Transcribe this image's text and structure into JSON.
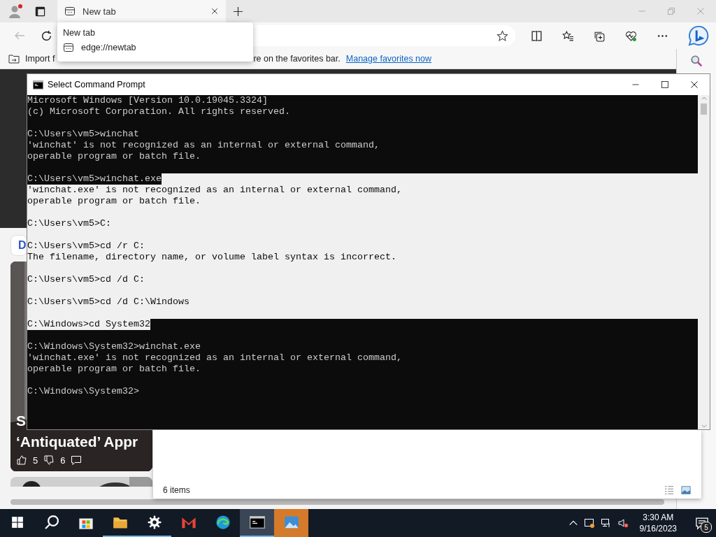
{
  "browser": {
    "tabs": [
      {
        "label": "New tab",
        "selected": true
      }
    ],
    "tooltip": {
      "title": "New tab",
      "url": "edge://newtab"
    },
    "favorites_bar": {
      "text_before": "Import f",
      "text_after": "re on the favorites bar.",
      "link": "Manage favorites now"
    },
    "page": {
      "button": "D",
      "card": {
        "title_lines": [
          "S",
          "‘Antiquated’ Appr"
        ],
        "likes": "5",
        "dislikes": "6"
      }
    }
  },
  "cmd": {
    "title": "Select Command Prompt",
    "lines": [
      {
        "kind": "text",
        "text": "Microsoft Windows [Version 10.0.19045.3324]",
        "selected": false
      },
      {
        "kind": "text",
        "text": "(c) Microsoft Corporation. All rights reserved.",
        "selected": false
      },
      {
        "kind": "blank",
        "selected": false
      },
      {
        "kind": "text",
        "text": "C:\\Users\\vm5>winchat",
        "selected": false
      },
      {
        "kind": "text",
        "text": "'winchat' is not recognized as an internal or external command,",
        "selected": false
      },
      {
        "kind": "text",
        "text": "operable program or batch file.",
        "selected": false
      },
      {
        "kind": "blank",
        "selected": false
      },
      {
        "kind": "text",
        "text": "C:\\Users\\vm5>winchat.exe",
        "selected": true
      },
      {
        "kind": "text",
        "text": "'winchat.exe' is not recognized as an internal or external command,",
        "selected": true
      },
      {
        "kind": "text",
        "text": "operable program or batch file.",
        "selected": true
      },
      {
        "kind": "blank",
        "selected": true
      },
      {
        "kind": "text",
        "text": "C:\\Users\\vm5>C:",
        "selected": true
      },
      {
        "kind": "blank",
        "selected": true
      },
      {
        "kind": "text",
        "text": "C:\\Users\\vm5>cd /r C:",
        "selected": true
      },
      {
        "kind": "text",
        "text": "The filename, directory name, or volume label syntax is incorrect.",
        "selected": true
      },
      {
        "kind": "blank",
        "selected": true
      },
      {
        "kind": "text",
        "text": "C:\\Users\\vm5>cd /d C:",
        "selected": true
      },
      {
        "kind": "blank",
        "selected": true
      },
      {
        "kind": "text",
        "text": "C:\\Users\\vm5>cd /d C:\\Windows",
        "selected": true
      },
      {
        "kind": "blank",
        "selected": true
      },
      {
        "kind": "text",
        "text": "C:\\Windows>cd System32",
        "selected": true
      },
      {
        "kind": "blank",
        "selected": false
      },
      {
        "kind": "text",
        "text": "C:\\Windows\\System32>winchat.exe",
        "selected": false
      },
      {
        "kind": "text",
        "text": "'winchat.exe' is not recognized as an internal or external command,",
        "selected": false
      },
      {
        "kind": "text",
        "text": "operable program or batch file.",
        "selected": false
      },
      {
        "kind": "blank",
        "selected": false
      },
      {
        "kind": "text",
        "text": "C:\\Windows\\System32>",
        "selected": false
      }
    ]
  },
  "explorer": {
    "status": "6 items"
  },
  "taskbar": {
    "apps": [
      {
        "kind": "start",
        "running": false,
        "active": false,
        "flashing": false
      },
      {
        "kind": "search",
        "running": false,
        "active": false,
        "flashing": false
      },
      {
        "kind": "store",
        "running": false,
        "active": false,
        "flashing": false
      },
      {
        "kind": "files",
        "running": true,
        "active": false,
        "flashing": false
      },
      {
        "kind": "settings",
        "running": true,
        "active": false,
        "flashing": false
      },
      {
        "kind": "mail",
        "running": false,
        "active": false,
        "flashing": false
      },
      {
        "kind": "browser",
        "running": false,
        "active": false,
        "flashing": false
      },
      {
        "kind": "terminal",
        "running": true,
        "active": true,
        "flashing": false
      },
      {
        "kind": "photos",
        "running": false,
        "active": false,
        "flashing": true
      }
    ],
    "time": "3:30 AM",
    "date": "9/16/2023",
    "notifications": "5"
  }
}
